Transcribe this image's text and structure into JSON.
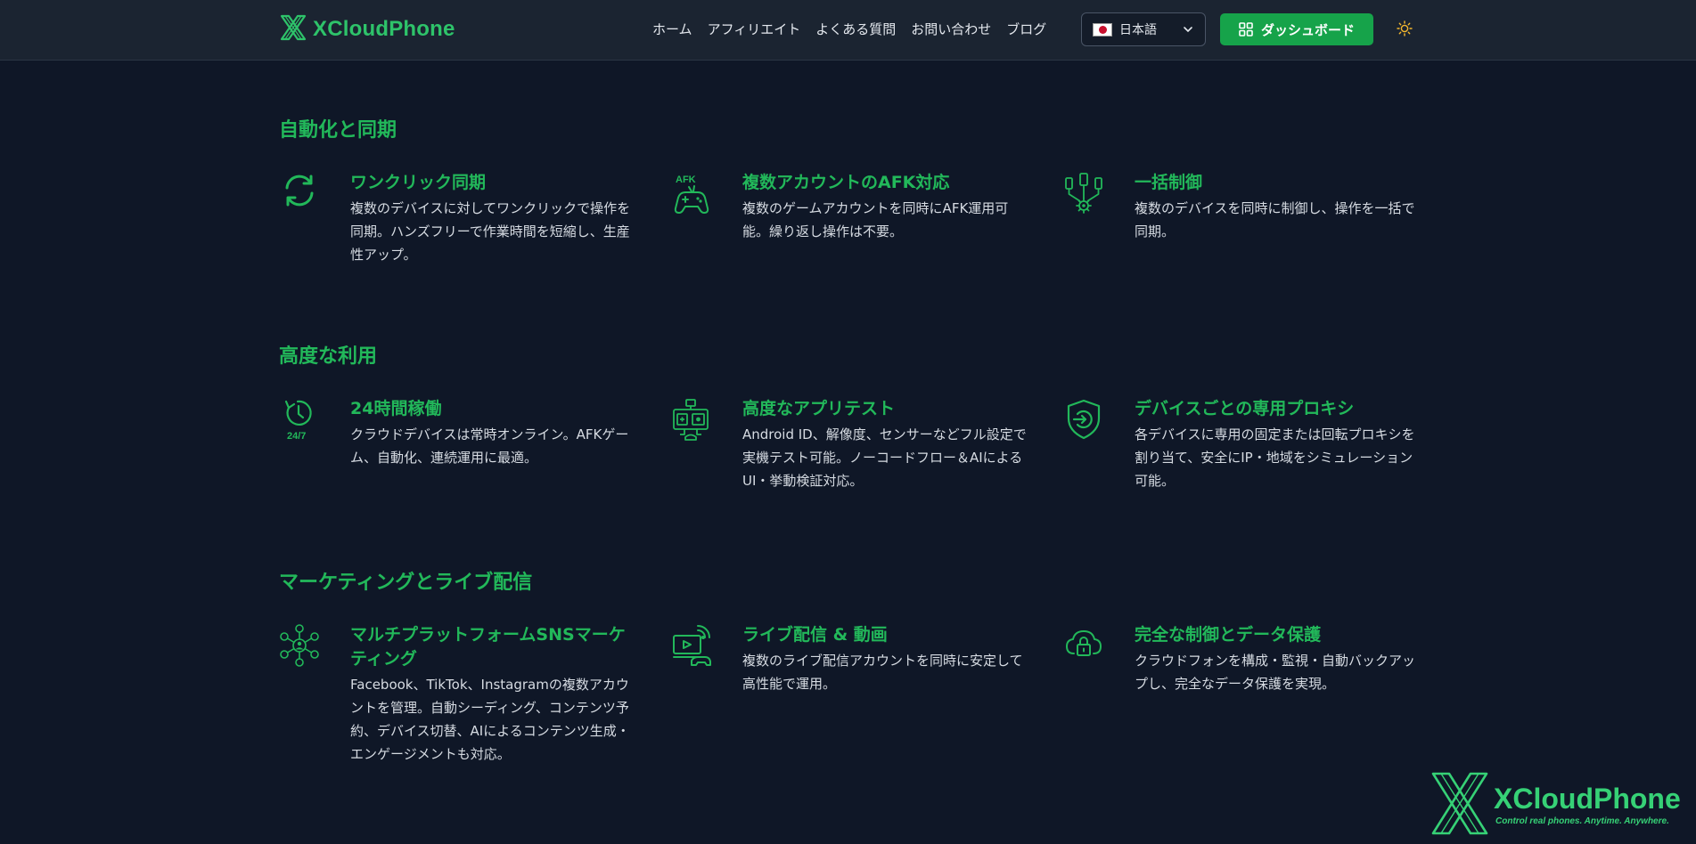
{
  "brand": {
    "name": "XCloudPhone"
  },
  "nav": {
    "links": [
      "ホーム",
      "アフィリエイト",
      "よくある質問",
      "お問い合わせ",
      "ブログ"
    ],
    "language": "日本語",
    "dashboard_label": "ダッシュボード"
  },
  "sections": [
    {
      "title": "自動化と同期",
      "features": [
        {
          "icon": "sync-icon",
          "title": "ワンクリック同期",
          "desc": "複数のデバイスに対してワンクリックで操作を同期。ハンズフリーで作業時間を短縮し、生産性アップ。"
        },
        {
          "icon": "afk-gamepad-icon",
          "icon_text": "AFK",
          "title": "複数アカウントのAFK対応",
          "desc": "複数のゲームアカウントを同時にAFK運用可能。繰り返し操作は不要。"
        },
        {
          "icon": "batch-control-icon",
          "title": "一括制御",
          "desc": "複数のデバイスを同時に制御し、操作を一括で同期。"
        }
      ]
    },
    {
      "title": "高度な利用",
      "features": [
        {
          "icon": "clock-24-7-icon",
          "icon_text": "24/7",
          "title": "24時間稼働",
          "desc": "クラウドデバイスは常時オンライン。AFKゲーム、自動化、連続運用に最適。"
        },
        {
          "icon": "app-test-icon",
          "title": "高度なアプリテスト",
          "desc": "Android ID、解像度、センサーなどフル設定で実機テスト可能。ノーコードフロー＆AIによるUI・挙動検証対応。"
        },
        {
          "icon": "proxy-shield-icon",
          "title": "デバイスごとの専用プロキシ",
          "desc": "各デバイスに専用の固定または回転プロキシを割り当て、安全にIP・地域をシミュレーション可能。"
        }
      ]
    },
    {
      "title": "マーケティングとライブ配信",
      "features": [
        {
          "icon": "social-network-icon",
          "title": "マルチプラットフォームSNSマーケティング",
          "desc": "Facebook、TikTok、Instagramの複数アカウントを管理。自動シーディング、コンテンツ予約、デバイス切替、AIによるコンテンツ生成・エンゲージメントも対応。"
        },
        {
          "icon": "live-stream-icon",
          "title": "ライブ配信 & 動画",
          "desc": "複数のライブ配信アカウントを同時に安定して高性能で運用。"
        },
        {
          "icon": "cloud-lock-icon",
          "title": "完全な制御とデータ保護",
          "desc": "クラウドフォンを構成・監視・自動バックアップし、完全なデータ保護を実現。"
        }
      ]
    }
  ],
  "watermark": {
    "name": "XCloudPhone",
    "tagline": "Control real phones. Anytime. Anywhere."
  },
  "colors": {
    "accent": "#22b85a",
    "button": "#16a34a",
    "background": "#0f1727",
    "navbar": "#1b2431"
  }
}
